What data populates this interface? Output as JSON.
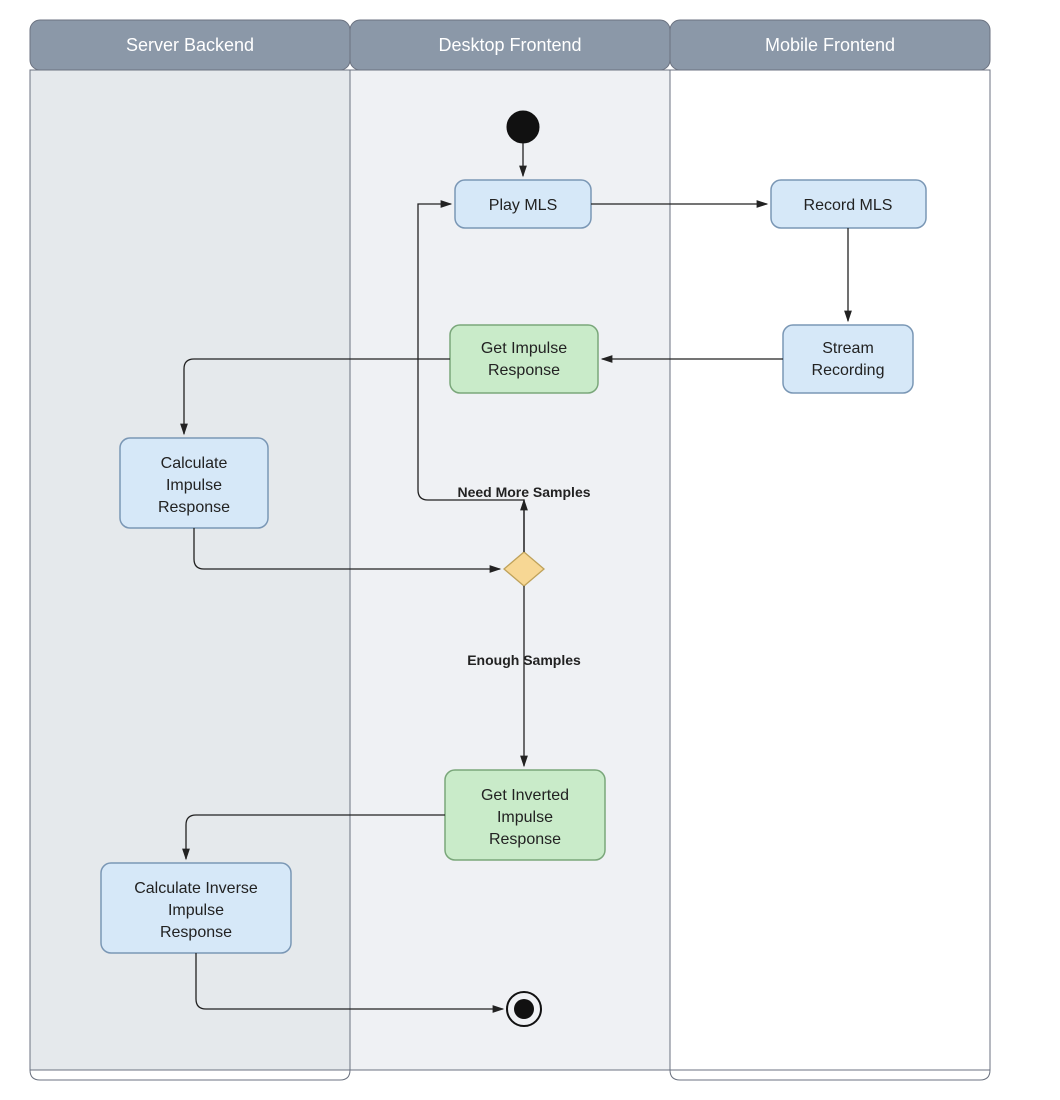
{
  "lanes": {
    "server": "Server Backend",
    "desktop": "Desktop Frontend",
    "mobile": "Mobile Frontend"
  },
  "nodes": {
    "play_mls": "Play MLS",
    "record_mls": "Record MLS",
    "stream_recording_l1": "Stream",
    "stream_recording_l2": "Recording",
    "get_impulse_l1": "Get Impulse",
    "get_impulse_l2": "Response",
    "calc_impulse_l1": "Calculate",
    "calc_impulse_l2": "Impulse",
    "calc_impulse_l3": "Response",
    "get_inv_l1": "Get Inverted",
    "get_inv_l2": "Impulse",
    "get_inv_l3": "Response",
    "calc_inv_l1": "Calculate Inverse",
    "calc_inv_l2": "Impulse",
    "calc_inv_l3": "Response"
  },
  "labels": {
    "need_more": "Need More Samples",
    "enough": "Enough Samples"
  }
}
